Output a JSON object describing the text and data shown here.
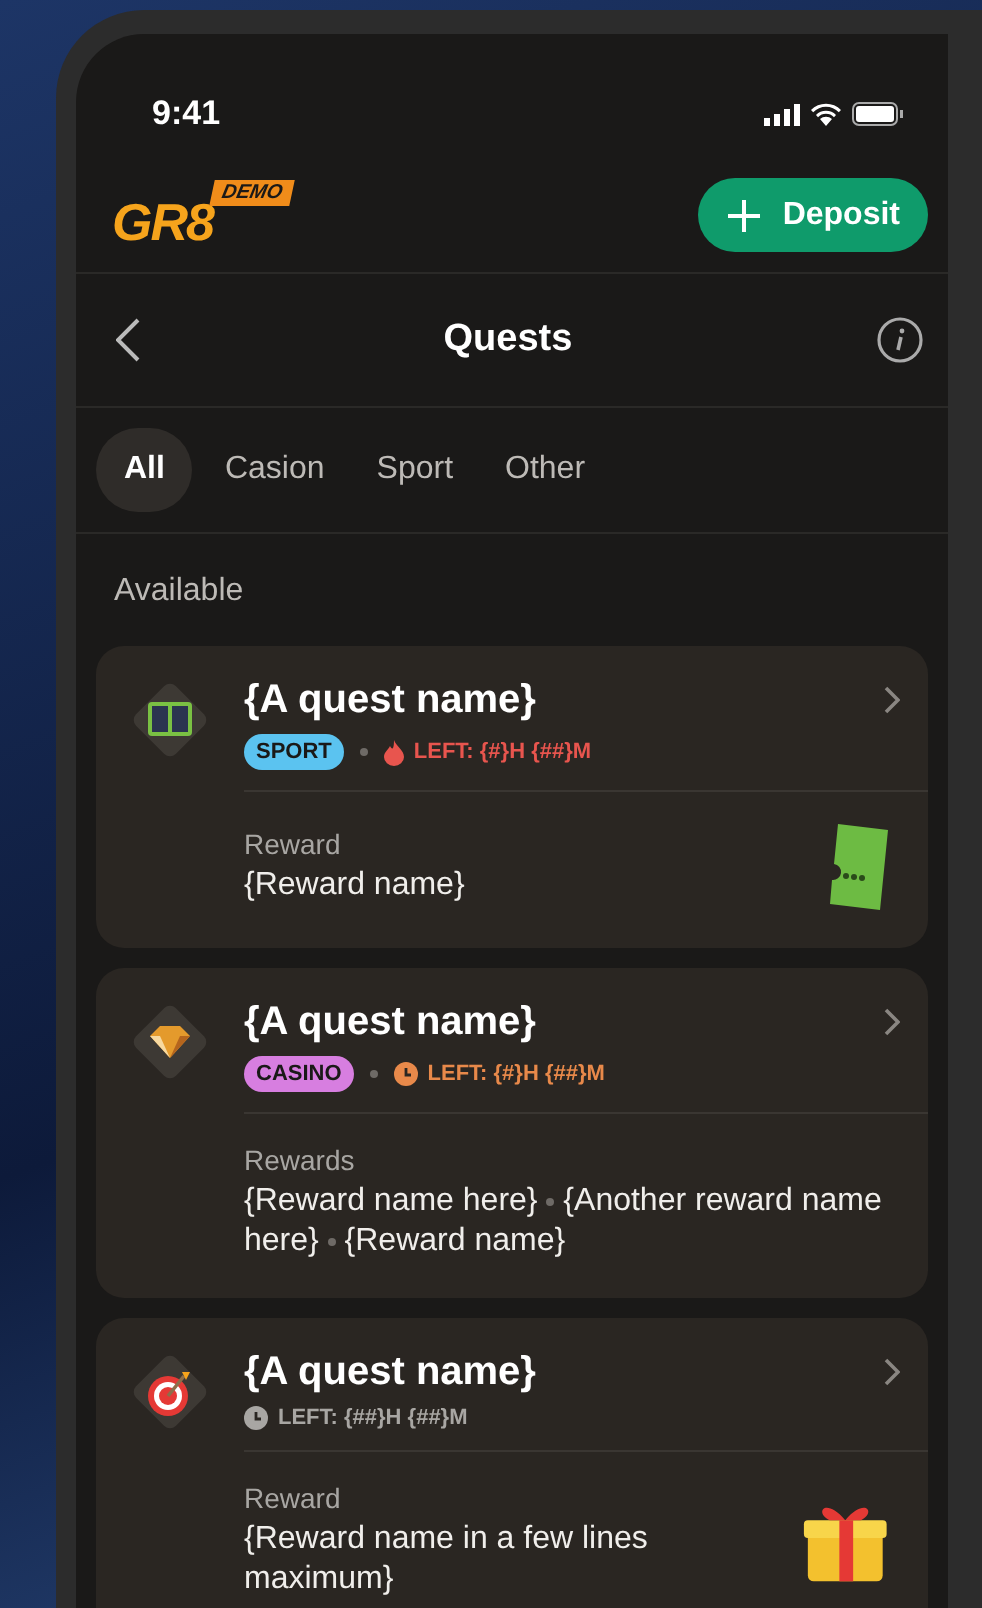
{
  "status_bar": {
    "time": "9:41"
  },
  "header": {
    "logo": "GR8",
    "logo_badge": "DEMO",
    "deposit_button": "Deposit"
  },
  "nav": {
    "title": "Quests"
  },
  "tabs": [
    {
      "label": "All",
      "selected": true
    },
    {
      "label": "Casion",
      "selected": false
    },
    {
      "label": "Sport",
      "selected": false
    },
    {
      "label": "Other",
      "selected": false
    }
  ],
  "section_title": "Available",
  "quests": [
    {
      "kind": "sport",
      "name": "{A quest name}",
      "tag": {
        "label": "SPORT",
        "color": "#5bc3f0"
      },
      "timer": {
        "kind": "fire",
        "text": "LEFT: {#}H {##}M",
        "color": "#e8554e"
      },
      "reward_label": "Reward",
      "rewards": [
        "{Reward name}"
      ],
      "reward_icon": {
        "kind": "ticket"
      }
    },
    {
      "kind": "casino",
      "name": "{A quest name}",
      "tag": {
        "label": "CASINO",
        "color": "#d77ee0"
      },
      "timer": {
        "kind": "clock",
        "text": "LEFT: {#}H {##}M",
        "color": "#e8894a"
      },
      "reward_label": "Rewards",
      "rewards": [
        "{Reward name here}",
        "{Another reward name here}",
        "{Reward name}"
      ]
    },
    {
      "kind": "target",
      "name": "{A quest name}",
      "timer": {
        "kind": "clock",
        "text": "LEFT: {##}H {##}M",
        "color": "#a8a6a3"
      },
      "reward_label": "Reward",
      "rewards": [
        "{Reward name in a few lines maximum}"
      ],
      "reward_icon": {
        "kind": "gift"
      }
    }
  ]
}
